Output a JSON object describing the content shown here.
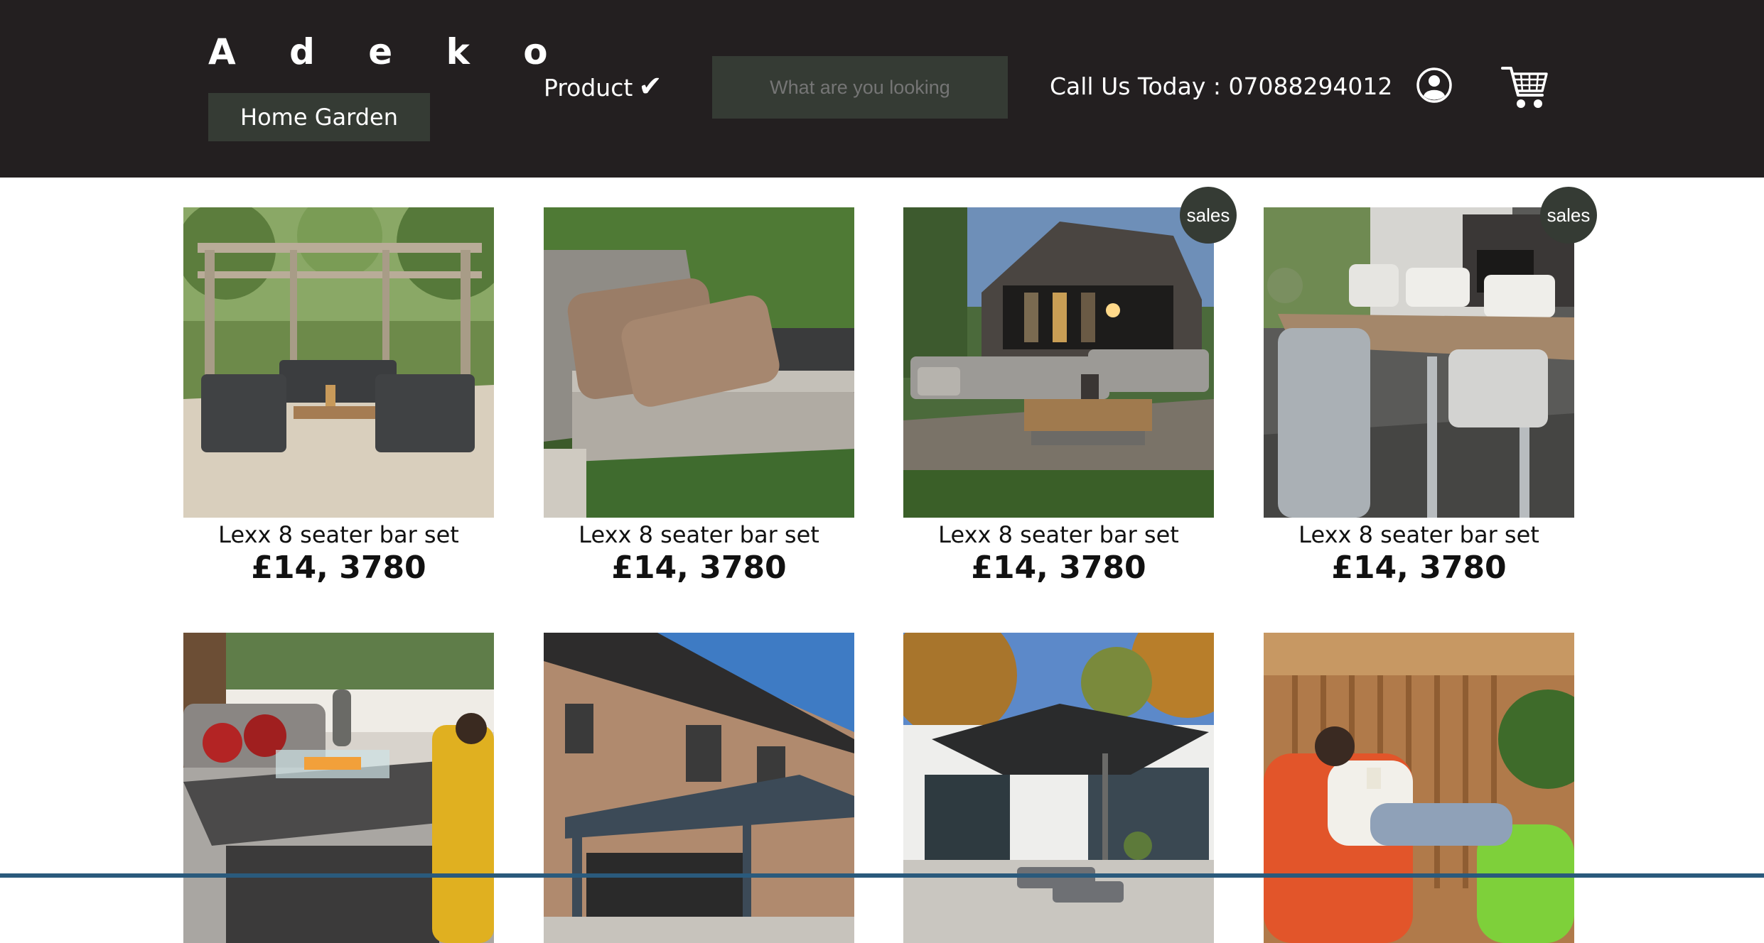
{
  "header": {
    "logo": "A d e k o",
    "category_button": "Home Garden",
    "product_nav_label": "Product",
    "product_nav_check": "✔",
    "search_placeholder": "What are you looking",
    "call_us": "Call Us Today : 07088294012",
    "user_icon": "user-circle-icon",
    "cart_icon": "shopping-cart-icon"
  },
  "products": [
    {
      "title": "Lexx 8 seater bar set",
      "price": "£14, 3780",
      "badge": "",
      "image": "pergola-lounge-set"
    },
    {
      "title": "Lexx 8 seater bar set",
      "price": "£14, 3780",
      "badge": "",
      "image": "lounge-chair-cushions"
    },
    {
      "title": "Lexx 8 seater bar set",
      "price": "£14, 3780",
      "badge": "sales",
      "image": "corner-sofa-coffee-table"
    },
    {
      "title": "Lexx 8 seater bar set",
      "price": "£14, 3780",
      "badge": "sales",
      "image": "dining-table-chairs"
    },
    {
      "image": "fire-pit-table"
    },
    {
      "image": "louvred-pergola"
    },
    {
      "image": "cantilever-parasol"
    },
    {
      "image": "bean-bag-chairs"
    }
  ],
  "colors": {
    "header_bg": "#231f20",
    "accent_box": "#353b34",
    "text_light": "#ffffff"
  }
}
